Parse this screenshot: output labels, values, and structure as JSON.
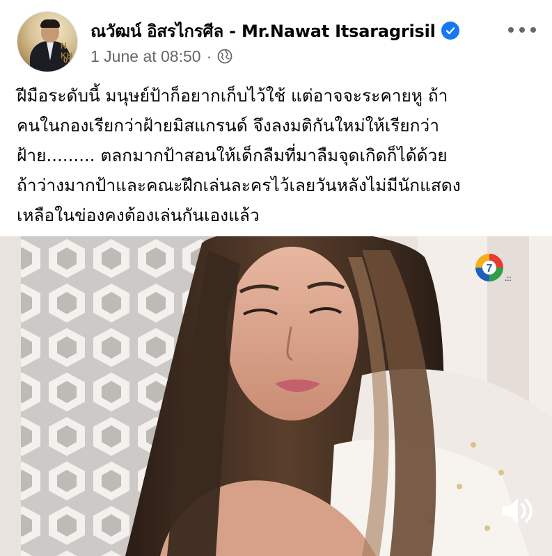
{
  "post": {
    "author": "ณวัฒน์ อิสรไกรศีล - Mr.Nawat Itsaragrisil",
    "verified": true,
    "timestamp": "1 June at 08:50",
    "separator": "·",
    "audience_icon": "globe-icon",
    "more_icon": "more-options-icon",
    "text_lines": [
      "ฝีมือระดับนี้ มนุษย์ป้าก็อยากเก็บไว้ใช้ แต่อาจจะระคายหู ถ้า",
      "คนในกองเรียกว่าฝ้ายมิสแกรนด์ จึงลงมติกันใหม่ให้เรียกว่า",
      "ฝ้าย......... ตลกมากป้าสอนให้เด็กลืมที่มาลืมจุดเกิดก็ได้ด้วย",
      "ถ้าว่างมากป้าและคณะฝึกเล่นละครไว้เลยวันหลังไม่มีนักแสดง",
      "เหลือในข่องคงต้องเล่นกันเองแล้ว"
    ]
  },
  "avatar": {
    "text_a": "N KH",
    "text_b": "017"
  },
  "video": {
    "channel_logo": "channel-7-logo",
    "channel_number": "7",
    "sound_icon": "volume-icon"
  },
  "colors": {
    "verified_blue": "#1877f2",
    "secondary_text": "#65676b",
    "primary_text": "#050505"
  }
}
